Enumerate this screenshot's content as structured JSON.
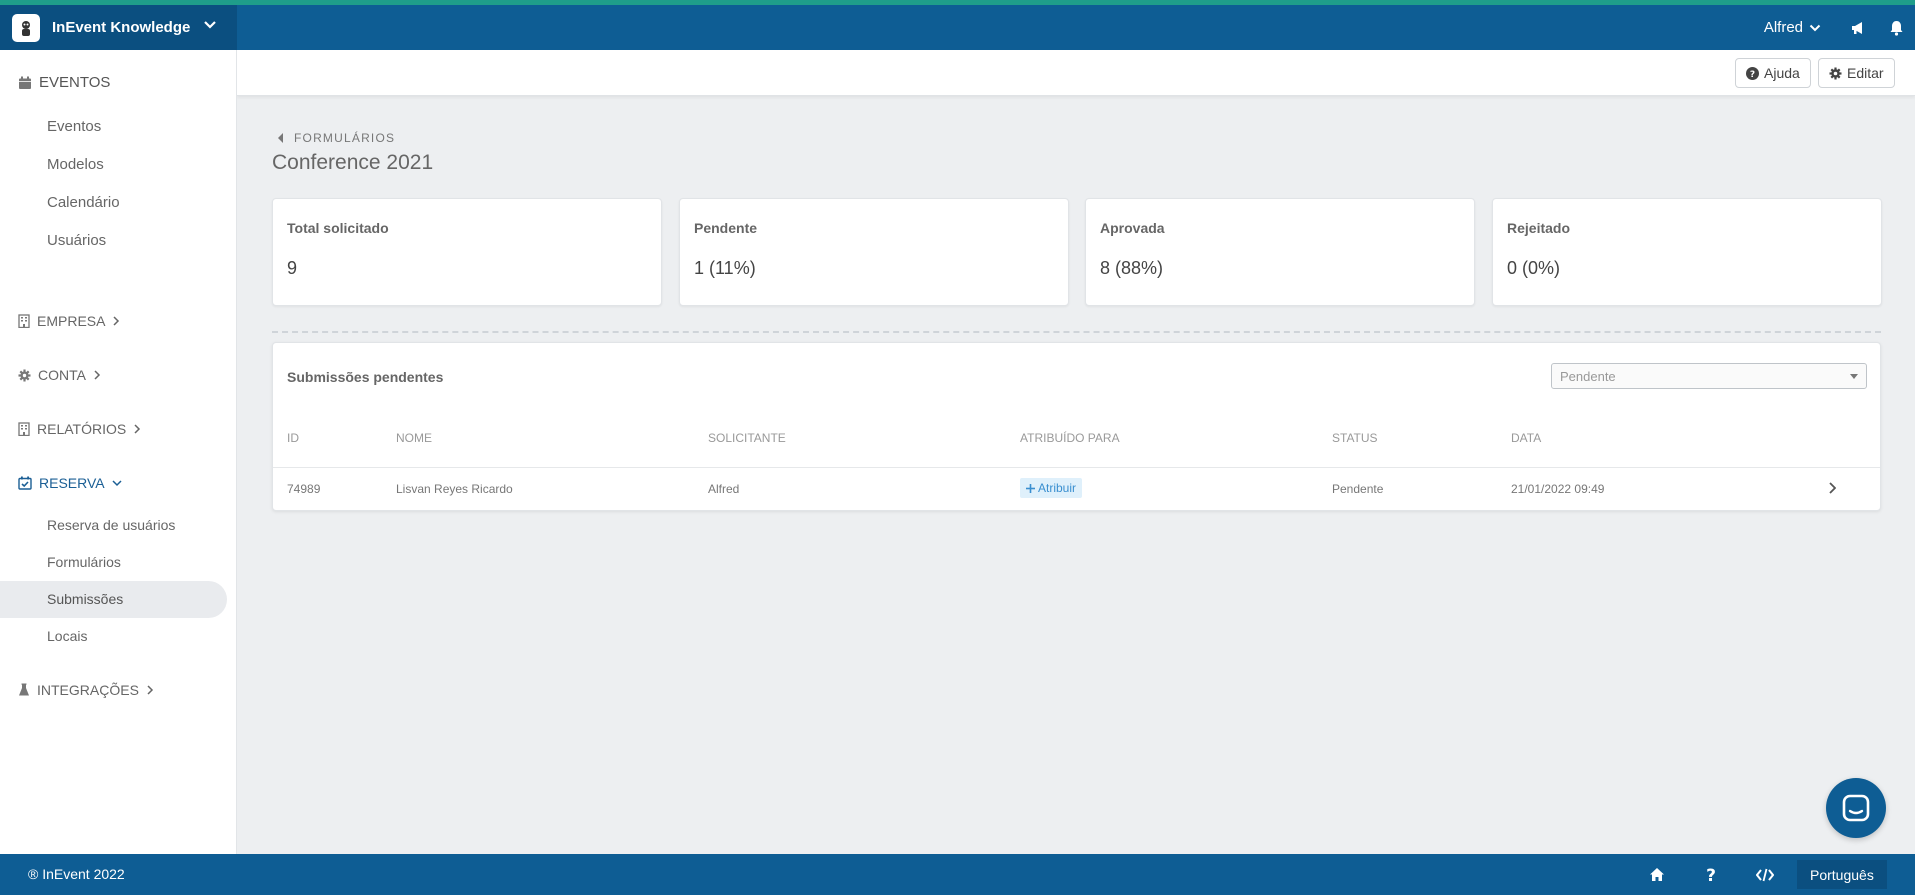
{
  "header": {
    "brand": "InEvent Knowledge",
    "user": "Alfred"
  },
  "subheader": {
    "help_label": "Ajuda",
    "edit_label": "Editar"
  },
  "sidebar": {
    "eventos": {
      "label": "EVENTOS",
      "items": [
        "Eventos",
        "Modelos",
        "Calendário",
        "Usuários"
      ]
    },
    "empresa": "EMPRESA",
    "conta": "CONTA",
    "relatorios": "RELATÓRIOS",
    "reserva": {
      "label": "RESERVA",
      "items": [
        "Reserva de usuários",
        "Formulários",
        "Submissões",
        "Locais"
      ]
    },
    "integracoes": "INTEGRAÇÕES"
  },
  "main": {
    "breadcrumb": "FORMULÁRIOS",
    "title": "Conference 2021",
    "cards": [
      {
        "label": "Total solicitado",
        "value": "9"
      },
      {
        "label": "Pendente",
        "value": "1 (11%)"
      },
      {
        "label": "Aprovada",
        "value": "8 (88%)"
      },
      {
        "label": "Rejeitado",
        "value": "0 (0%)"
      }
    ],
    "panel": {
      "title": "Submissões pendentes",
      "filter_value": "Pendente",
      "columns": [
        "ID",
        "NOME",
        "SOLICITANTE",
        "ATRIBUÍDO PARA",
        "STATUS",
        "DATA"
      ],
      "rows": [
        {
          "id": "74989",
          "name": "Lisvan Reyes Ricardo",
          "requester": "Alfred",
          "assign_label": "Atribuir",
          "status": "Pendente",
          "date": "21/01/2022 09:49"
        }
      ]
    }
  },
  "footer": {
    "copyright": "® InEvent 2022",
    "language": "Português"
  },
  "colors": {
    "primary": "#0e5d94",
    "primary_dark": "#0b4f80",
    "accent_strip": "#1f9d8a",
    "background": "#edeff1"
  }
}
